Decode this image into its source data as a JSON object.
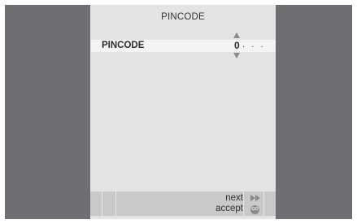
{
  "screen": {
    "title": "PINCODE"
  },
  "pincode_row": {
    "label": "PINCODE",
    "value": "0",
    "remaining_digits": ". . ."
  },
  "footer": {
    "next_label": "next",
    "accept_label": "accept",
    "next_icon": "fast-forward-icon",
    "accept_icon": "go-icon",
    "go_icon_text": "GO"
  },
  "colors": {
    "side_panel": "#6e6f72",
    "menu_background": "#e4e4e4",
    "highlight_row": "#f4f4f4",
    "footer_bar": "#c9c9c9"
  }
}
